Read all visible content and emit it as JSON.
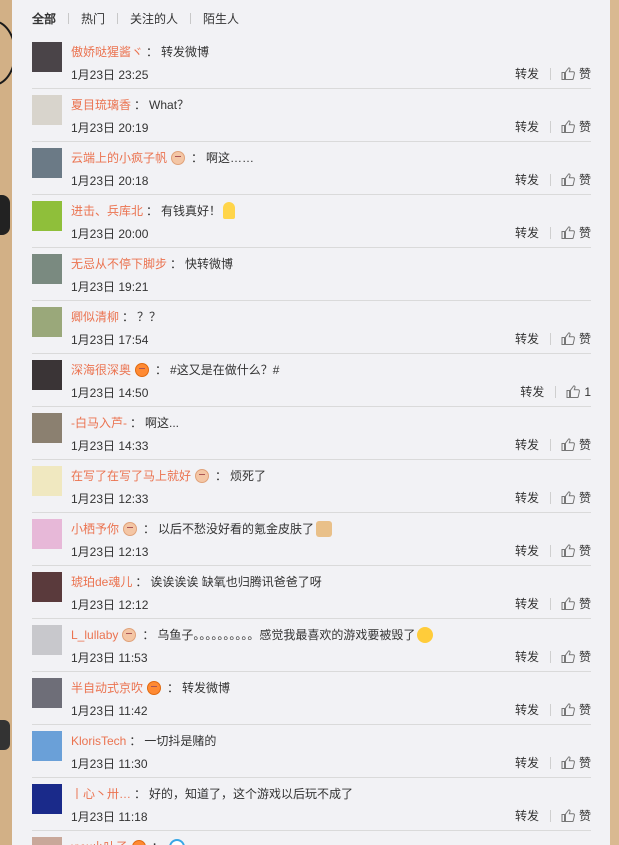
{
  "tabs": [
    "全部",
    "热门",
    "关注的人",
    "陌生人"
  ],
  "actions": {
    "repost": "转发",
    "like": "赞"
  },
  "comments": [
    {
      "user": "傲娇哒猩酱ヾ",
      "badge": "",
      "text": "转发微博",
      "emoji": "",
      "time": "1月23日 23:25",
      "like_label": "赞",
      "show_actions": true,
      "avatar_color": "#4a4448"
    },
    {
      "user": "夏目琉璃香",
      "badge": "",
      "text": "What？",
      "emoji": "",
      "time": "1月23日 20:19",
      "like_label": "赞",
      "show_actions": true,
      "avatar_color": "#d8d4cc"
    },
    {
      "user": "云端上的小疯子帆",
      "badge": "peach",
      "text": "啊这……",
      "emoji": "",
      "time": "1月23日 20:18",
      "like_label": "赞",
      "show_actions": true,
      "avatar_color": "#6b7a86"
    },
    {
      "user": "进击、兵库北",
      "badge": "",
      "text": "有钱真好！",
      "emoji": "fig",
      "time": "1月23日 20:00",
      "like_label": "赞",
      "show_actions": true,
      "avatar_color": "#8fbf3a"
    },
    {
      "user": "无忌从不停下脚步",
      "badge": "",
      "text": "快转微博",
      "emoji": "",
      "time": "1月23日 19:21",
      "like_label": "",
      "show_actions": false,
      "avatar_color": "#7a8a80"
    },
    {
      "user": "卿似清柳",
      "badge": "",
      "text": "？？",
      "emoji": "",
      "time": "1月23日 17:54",
      "like_label": "赞",
      "show_actions": true,
      "avatar_color": "#9aa87a"
    },
    {
      "user": "深海很深奥",
      "badge": "orange",
      "text": "#这又是在做什么？#",
      "emoji": "",
      "time": "1月23日 14:50",
      "like_label": "1",
      "show_actions": true,
      "avatar_color": "#3a3436"
    },
    {
      "user": "-白马入芦-",
      "badge": "",
      "text": "啊这...",
      "emoji": "",
      "time": "1月23日 14:33",
      "like_label": "赞",
      "show_actions": true,
      "avatar_color": "#8b8070"
    },
    {
      "user": "在写了在写了马上就好",
      "badge": "peach",
      "text": "烦死了",
      "emoji": "",
      "time": "1月23日 12:33",
      "like_label": "赞",
      "show_actions": true,
      "avatar_color": "#f0e8c0"
    },
    {
      "user": "小栖予你",
      "badge": "peach",
      "text": "以后不愁没好看的氪金皮肤了",
      "emoji": "cat",
      "time": "1月23日 12:13",
      "like_label": "赞",
      "show_actions": true,
      "avatar_color": "#e7b8d8"
    },
    {
      "user": "琥珀de魂儿",
      "badge": "",
      "text": "诶诶诶诶 缺氧也归腾讯爸爸了呀",
      "emoji": "",
      "time": "1月23日 12:12",
      "like_label": "赞",
      "show_actions": true,
      "avatar_color": "#5a3a3c"
    },
    {
      "user": "L_lullaby",
      "badge": "peach",
      "text": "乌鱼子。。。。。。。。。。感觉我最喜欢的游戏要被毁了",
      "emoji": "cry",
      "time": "1月23日 11:53",
      "like_label": "赞",
      "show_actions": true,
      "avatar_color": "#c8c8cc"
    },
    {
      "user": "半自动式京吹",
      "badge": "orange",
      "text": "转发微博",
      "emoji": "",
      "time": "1月23日 11:42",
      "like_label": "赞",
      "show_actions": true,
      "avatar_color": "#6e6e78"
    },
    {
      "user": "KlorisTech",
      "badge": "",
      "text": "一切抖是赌的",
      "emoji": "",
      "time": "1月23日 11:30",
      "like_label": "赞",
      "show_actions": true,
      "avatar_color": "#6aa0d8"
    },
    {
      "user": "丨心丶卅…",
      "badge": "",
      "text": "好的，知道了，这个游戏以后玩不成了",
      "emoji": "",
      "time": "1月23日 11:18",
      "like_label": "赞",
      "show_actions": true,
      "avatar_color": "#1a2a8a"
    },
    {
      "user": "xyw小叶子",
      "badge": "orange",
      "text": "",
      "emoji": "dora",
      "time": "",
      "like_label": "",
      "show_actions": false,
      "avatar_color": "#c9a89a"
    }
  ]
}
